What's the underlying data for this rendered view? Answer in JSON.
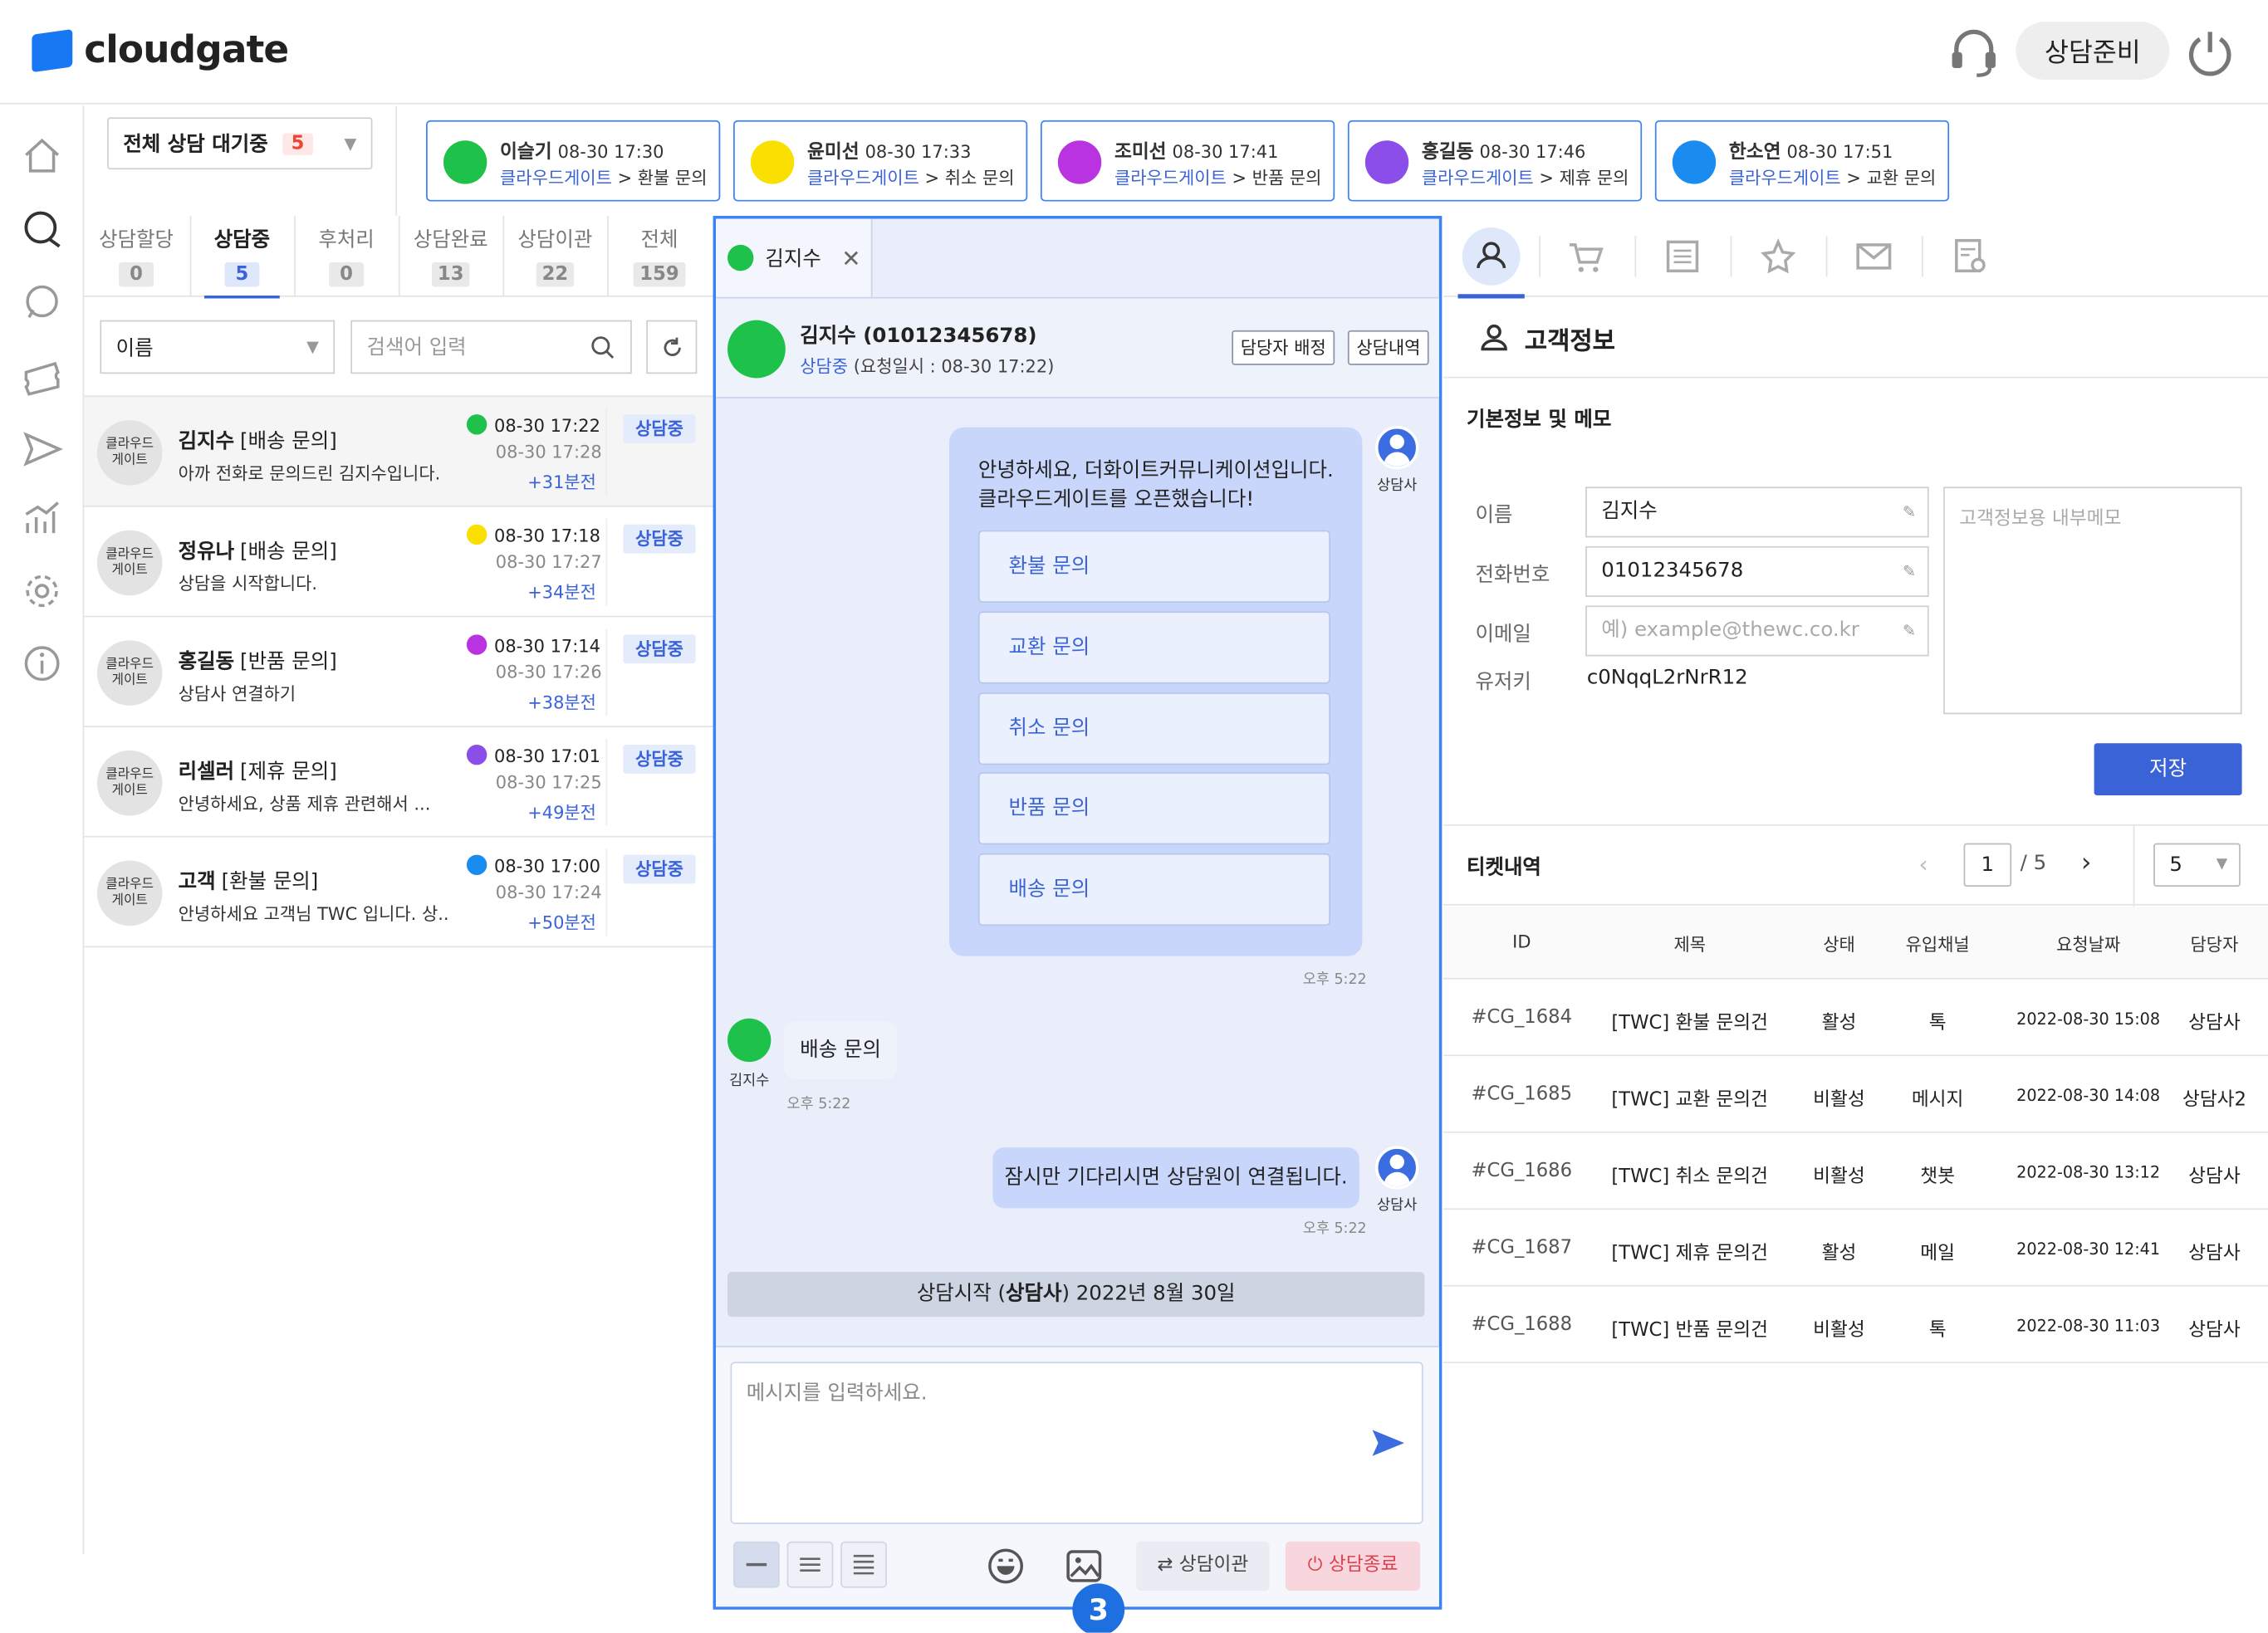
{
  "header": {
    "brand": "cloudgate",
    "status_label": "상담준비"
  },
  "queue": {
    "select_label": "전체 상담 대기중",
    "count": "5"
  },
  "queue_cards": [
    {
      "name": "이슬기",
      "time": "08-30 17:30",
      "source": "클라우드게이트",
      "topic": "> 환불 문의",
      "channel_color": "#1ec24a"
    },
    {
      "name": "윤미선",
      "time": "08-30 17:33",
      "source": "클라우드게이트",
      "topic": "> 취소 문의",
      "channel_color": "#f9e000"
    },
    {
      "name": "조미선",
      "time": "08-30 17:41",
      "source": "클라우드게이트",
      "topic": "> 반품 문의",
      "channel_color": "#b934e0"
    },
    {
      "name": "홍길동",
      "time": "08-30 17:46",
      "source": "클라우드게이트",
      "topic": "> 제휴 문의",
      "channel_color": "#8c4ee8"
    },
    {
      "name": "한소연",
      "time": "08-30 17:51",
      "source": "클라우드게이트",
      "topic": "> 교환 문의",
      "channel_color": "#1a8cf0"
    }
  ],
  "tabs": [
    {
      "label": "상담할당",
      "count": "0"
    },
    {
      "label": "상담중",
      "count": "5"
    },
    {
      "label": "후처리",
      "count": "0"
    },
    {
      "label": "상담완료",
      "count": "13"
    },
    {
      "label": "상담이관",
      "count": "22"
    },
    {
      "label": "전체",
      "count": "159"
    }
  ],
  "filter": {
    "field": "이름",
    "search_placeholder": "검색어 입력"
  },
  "sessions": [
    {
      "avatar": "클라우드\n게이트",
      "name": "김지수",
      "topic": "[배송 문의]",
      "message": "아까 전화로 문의드린 김지수입니다.",
      "t1": "08-30 17:22",
      "t2": "08-30 17:28",
      "elapsed": "+31분전",
      "badge": "상담중",
      "channel_color": "#1ec24a"
    },
    {
      "avatar": "클라우드\n게이트",
      "name": "정유나",
      "topic": "[배송 문의]",
      "message": "상담을 시작합니다.",
      "t1": "08-30 17:18",
      "t2": "08-30 17:27",
      "elapsed": "+34분전",
      "badge": "상담중",
      "channel_color": "#f9e000"
    },
    {
      "avatar": "클라우드\n게이트",
      "name": "홍길동",
      "topic": "[반품 문의]",
      "message": "상담사 연결하기",
      "t1": "08-30 17:14",
      "t2": "08-30 17:26",
      "elapsed": "+38분전",
      "badge": "상담중",
      "channel_color": "#b934e0"
    },
    {
      "avatar": "클라우드\n게이트",
      "name": "리셀러",
      "topic": "[제휴 문의]",
      "message": "안녕하세요, 상품 제휴 관련해서 ...",
      "t1": "08-30 17:01",
      "t2": "08-30 17:25",
      "elapsed": "+49분전",
      "badge": "상담중",
      "channel_color": "#8c4ee8"
    },
    {
      "avatar": "클라우드\n게이트",
      "name": "고객",
      "topic": "[환불 문의]",
      "message": "안녕하세요 고객님 TWC 입니다. 상..",
      "t1": "08-30 17:00",
      "t2": "08-30 17:24",
      "elapsed": "+50분전",
      "badge": "상담중",
      "channel_color": "#1a8cf0"
    }
  ],
  "chat": {
    "tab_name": "김지수",
    "customer": "김지수 (01012345678)",
    "status": "상담중",
    "requested": "(요청일시 : 08-30 17:22)",
    "assign_button": "담당자 배정",
    "history_button": "상담내역",
    "welcome": "안녕하세요, 더화이트커뮤니케이션입니다.\n클라우드게이트를 오픈했습니다!",
    "quick_replies": [
      "환불 문의",
      "교환 문의",
      "취소 문의",
      "반품 문의",
      "배송 문의"
    ],
    "agent_label": "상담사",
    "customer_label": "김지수",
    "time1": "오후 5:22",
    "customer_msg": "배송 문의",
    "time2": "오후 5:22",
    "agent_msg": "잠시만 기다리시면 상담원이 연결됩니다.",
    "time3": "오후 5:22",
    "system_msg_prefix": "상담시작 (",
    "system_msg_bold": "상담사",
    "system_msg_suffix": ") 2022년 8월 30일",
    "input_placeholder": "메시지를 입력하세요.",
    "transfer_button": "상담이관",
    "end_button": "상담종료",
    "step_marker": "3"
  },
  "customer_info": {
    "section_title": "고객정보",
    "subsection": "기본정보 및 메모",
    "name_label": "이름",
    "name_value": "김지수",
    "phone_label": "전화번호",
    "phone_value": "01012345678",
    "email_label": "이메일",
    "email_placeholder": "예) example@thewc.co.kr",
    "userkey_label": "유저키",
    "userkey_value": "c0NqqL2rNrR12",
    "memo_placeholder": "고객정보용 내부메모",
    "save_button": "저장"
  },
  "tickets": {
    "title": "티켓내역",
    "page": "1",
    "total_pages": "/ 5",
    "page_size": "5",
    "columns": [
      "ID",
      "제목",
      "상태",
      "유입채널",
      "요청날짜",
      "담당자"
    ],
    "rows": [
      [
        "#CG_1684",
        "[TWC] 환불 문의건",
        "활성",
        "톡",
        "2022-08-30 15:08",
        "상담사"
      ],
      [
        "#CG_1685",
        "[TWC] 교환 문의건",
        "비활성",
        "메시지",
        "2022-08-30 14:08",
        "상담사2"
      ],
      [
        "#CG_1686",
        "[TWC] 취소 문의건",
        "비활성",
        "챗봇",
        "2022-08-30 13:12",
        "상담사"
      ],
      [
        "#CG_1687",
        "[TWC] 제휴 문의건",
        "활성",
        "메일",
        "2022-08-30 12:41",
        "상담사"
      ],
      [
        "#CG_1688",
        "[TWC] 반품 문의건",
        "비활성",
        "톡",
        "2022-08-30 11:03",
        "상담사"
      ]
    ]
  },
  "colors": {
    "accent": "#3b63d8",
    "focus_border": "#3b82f6",
    "end_red": "#e0414f"
  }
}
